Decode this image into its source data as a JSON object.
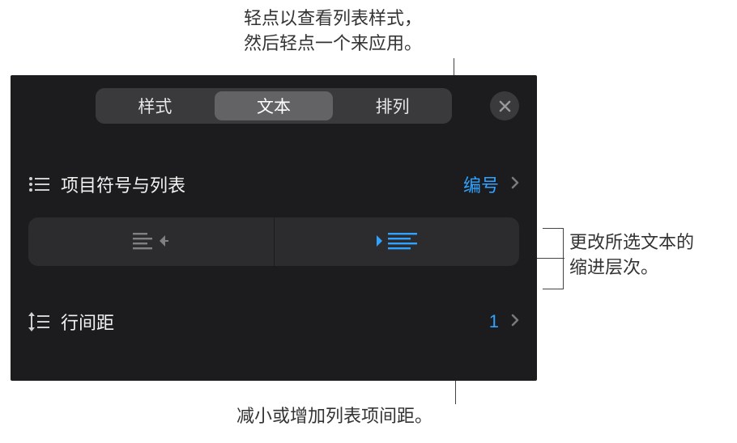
{
  "annotations": {
    "top": "轻点以查看列表样式，\n然后轻点一个来应用。",
    "right": "更改所选文本的\n缩进层次。",
    "bottom": "减小或增加列表项间距。"
  },
  "tabs": {
    "style": "样式",
    "text": "文本",
    "arrange": "排列"
  },
  "rows": {
    "bullets_label": "项目符号与列表",
    "bullets_value": "编号",
    "spacing_label": "行间距",
    "spacing_value": "1"
  },
  "colors": {
    "accent": "#2fa3ff",
    "panel_bg": "#1c1c1e",
    "button_bg": "#2c2c2e",
    "segmented_bg": "#3a3a3d",
    "segmented_active": "#636366"
  }
}
